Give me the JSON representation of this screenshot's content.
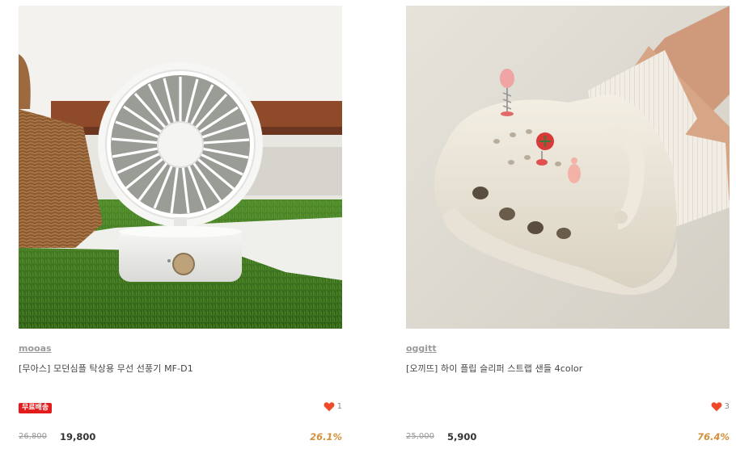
{
  "products": [
    {
      "brand": "mooas",
      "name": "[무아스] 모던심플 탁상용 무선 선풍기 MF-D1",
      "badge": "무료배송",
      "likes": "1",
      "original_price": "26,800",
      "sale_price": "19,800",
      "discount": "26.1%",
      "image_label": "mooas"
    },
    {
      "brand": "oggitt",
      "name": "[오끼뜨] 하이 플립 슬리퍼 스트랩 샌들 4color",
      "badge": "",
      "likes": "3",
      "original_price": "25,000",
      "sale_price": "5,900",
      "discount": "76.4%"
    }
  ],
  "colors": {
    "badge": "#e21c1c",
    "heart": "#ee4a2a",
    "discount": "#d4913a",
    "brand": "#9a9a9a"
  },
  "icons": {
    "like": "heart-icon"
  }
}
